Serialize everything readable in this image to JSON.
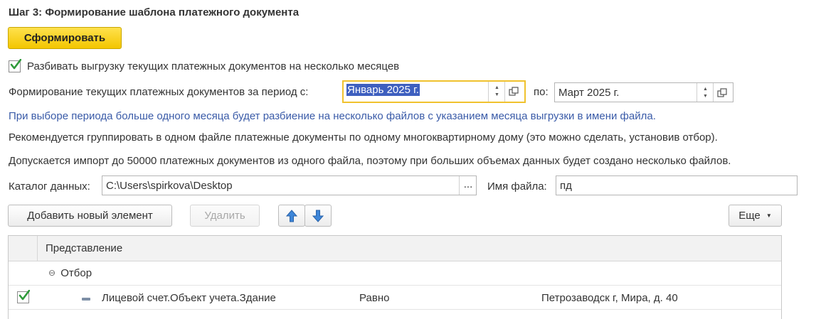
{
  "step_title": "Шаг 3: Формирование шаблона платежного документа",
  "form_button": "Сформировать",
  "split_checkbox": {
    "checked": true,
    "label": "Разбивать выгрузку текущих платежных документов на несколько месяцев"
  },
  "period": {
    "label": "Формирование текущих платежных документов за период с:",
    "from_value": "Январь 2025 г.",
    "to_label": "по:",
    "to_value": "Март 2025 г."
  },
  "info_note": "При выборе периода больше одного месяца будет разбиение на несколько файлов с указанием месяца выгрузки в имени файла.",
  "recommend_text": "Рекомендуется группировать в одном файле платежные документы по одному многоквартирному дому (это можно сделать, установив отбор).",
  "limit_text": "Допускается импорт до 50000 платежных документов из одного файла, поэтому при больших объемах данных будет создано несколько файлов.",
  "catalog": {
    "label": "Каталог данных:",
    "value": "C:\\Users\\spirkova\\Desktop",
    "browse": "..."
  },
  "filename": {
    "label": "Имя файла:",
    "value": "пд"
  },
  "toolbar": {
    "add": "Добавить новый элемент",
    "delete": "Удалить",
    "more": "Еще"
  },
  "grid": {
    "header": "Представление",
    "group_label": "Отбор",
    "rows": [
      {
        "checked": true,
        "field": "Лицевой счет.Объект учета.Здание",
        "comparison": "Равно",
        "value": "Петрозаводск г, Мира, д. 40"
      }
    ]
  },
  "colors": {
    "accent_yellow": "#f3c600",
    "info_blue": "#3a5ba8",
    "selection": "#3e5fbf",
    "check_green": "#2e9a3a"
  }
}
